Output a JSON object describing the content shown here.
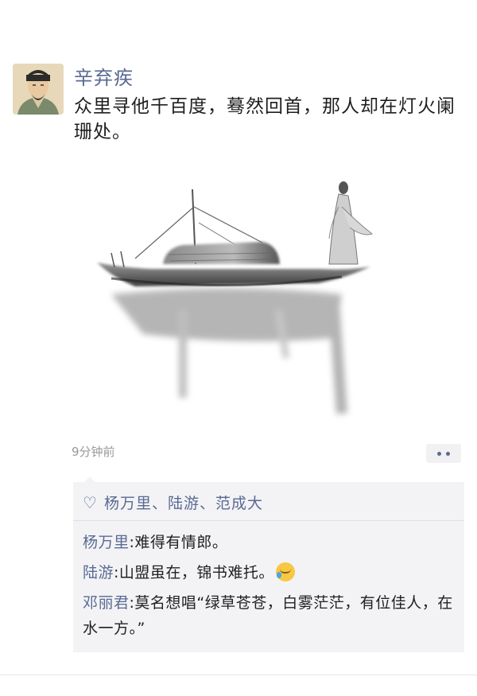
{
  "post": {
    "author": "辛弃疾",
    "text": "众里寻他千百度，蓦然回首，那人却在灯火阑珊处。",
    "time": "9分钟前",
    "image_icon": "ink-painting-boat-icon",
    "avatar_icon": "ancient-scholar-avatar-icon"
  },
  "likes": {
    "icon": "heart-icon",
    "names": "杨万里、陆游、范成大"
  },
  "comments": [
    {
      "name": "杨万里",
      "text": ":难得有情郎。"
    },
    {
      "name": "陆游",
      "text": ":山盟虽在，锦书难托。",
      "emoji": "crying-face-icon"
    },
    {
      "name": "邓丽君",
      "text": ":莫名想唱“绿草苍苍，白雾茫茫，有位佳人，在水一方。”"
    }
  ],
  "colors": {
    "accent": "#5a6a92",
    "panel": "#f3f3f5"
  }
}
